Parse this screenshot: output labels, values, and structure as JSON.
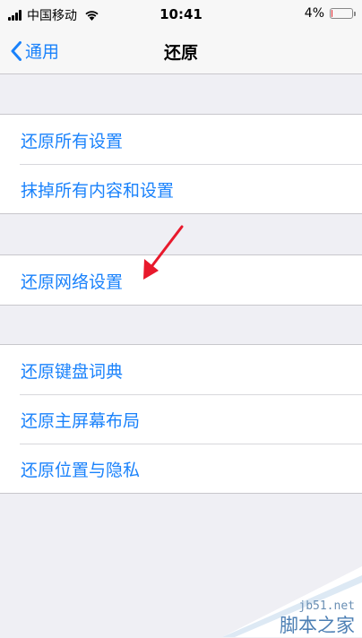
{
  "status_bar": {
    "carrier": "中国移动",
    "time": "10:41",
    "battery_percent": "4%",
    "battery_level": 0.04,
    "signal_icon": "signal-bars-icon",
    "wifi_icon": "wifi-icon"
  },
  "nav": {
    "back_label": "通用",
    "title": "还原"
  },
  "groups": [
    {
      "items": [
        "还原所有设置",
        "抹掉所有内容和设置"
      ]
    },
    {
      "items": [
        "还原网络设置"
      ]
    },
    {
      "items": [
        "还原键盘词典",
        "还原主屏幕布局",
        "还原位置与隐私"
      ]
    }
  ],
  "colors": {
    "accent": "#1a82fb",
    "background": "#efeff4",
    "arrow": "#e8192c"
  },
  "watermark": {
    "url": "jb51.net",
    "name": "脚本之家"
  }
}
